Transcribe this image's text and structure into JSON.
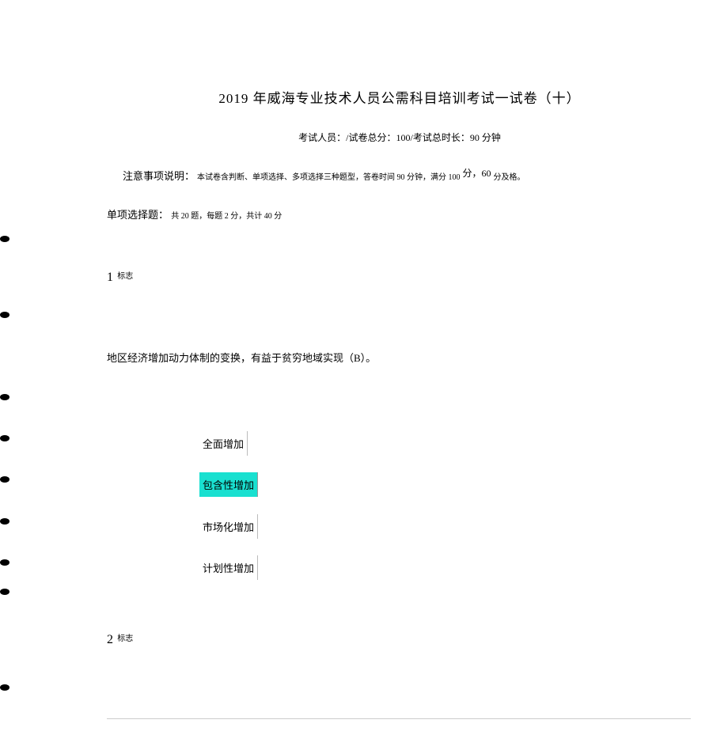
{
  "title": "2019 年威海专业技术人员公需科目培训考试一试卷（十）",
  "meta": "考试人员：/试卷总分：100/考试总时长：90 分钟",
  "notice": {
    "label": "注意事项说明：",
    "body_a": "本试卷含判断、单项选择、多项选择三种题型，答卷时间 90 分钟，满分 100",
    "score_word": "分，60",
    "body_b": "分及格。"
  },
  "section": {
    "label": "单项选择题：",
    "detail": "共 20 题，每题 2 分，共计 40 分"
  },
  "q1": {
    "num": "1",
    "flag": "标志",
    "text": "地区经济增加动力体制的变换，有益于贫穷地域实现（B）。",
    "options": {
      "a": "全面增加",
      "b": "包含性增加",
      "c": "市场化增加",
      "d": "计划性增加"
    }
  },
  "q2": {
    "num": "2",
    "flag": "标志"
  }
}
